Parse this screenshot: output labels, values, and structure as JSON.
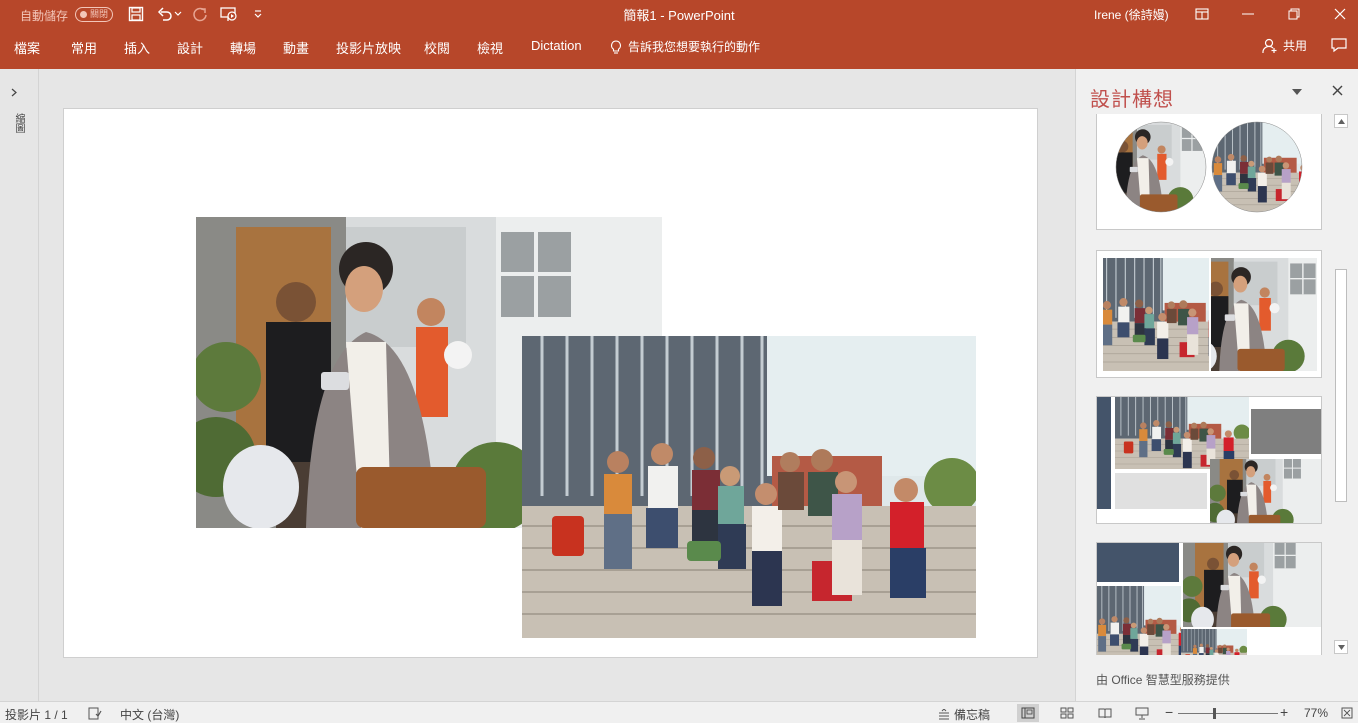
{
  "titlebar": {
    "autosave_label": "自動儲存",
    "autosave_state": "關閉",
    "document_title": "簡報1  -  PowerPoint",
    "user": "Irene (徐詩嫚)"
  },
  "ribbon": {
    "tabs": [
      "檔案",
      "常用",
      "插入",
      "設計",
      "轉場",
      "動畫",
      "投影片放映",
      "校閱",
      "檢視",
      "Dictation"
    ],
    "tell_me": "告訴我您想要執行的動作",
    "share": "共用"
  },
  "thumb_rail": {
    "label": "縮圖"
  },
  "design_pane": {
    "title": "設計構想",
    "footer": "由 Office 智慧型服務提供"
  },
  "statusbar": {
    "slide_info": "投影片 1 / 1",
    "language": "中文 (台灣)",
    "notes": "備忘稿",
    "zoom": "77%"
  },
  "colors": {
    "accent": "#b7472a",
    "pane_title": "#c0504d",
    "layout_dark": "#44546a",
    "layout_gray": "#7f7f7f"
  }
}
